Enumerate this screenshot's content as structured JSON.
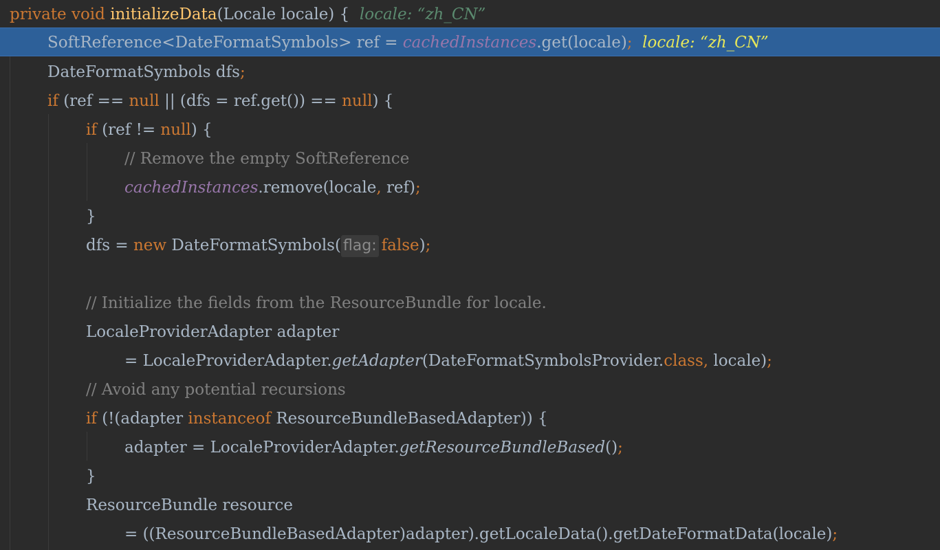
{
  "editor": {
    "lines": [
      {
        "tokens": [
          [
            "kw",
            "private "
          ],
          [
            "kw",
            "void "
          ],
          [
            "fn",
            "initializeData"
          ],
          [
            "tx",
            "(Locale locale) {  "
          ],
          [
            "iv",
            "locale: “zh_CN”"
          ]
        ]
      },
      {
        "tokens": [
          [
            "tx",
            "SoftReference<DateFormatSymbols> ref = "
          ],
          [
            "fi",
            "cachedInstances"
          ],
          [
            "tx",
            ".get(locale)"
          ],
          [
            "pu",
            ";  "
          ],
          [
            "iv-hl",
            "locale: “zh_CN”"
          ]
        ]
      },
      {
        "tokens": [
          [
            "tx",
            "DateFormatSymbols dfs"
          ],
          [
            "pu",
            ";"
          ]
        ]
      },
      {
        "tokens": [
          [
            "kw",
            "if "
          ],
          [
            "tx",
            "(ref == "
          ],
          [
            "kw",
            "null"
          ],
          [
            "tx",
            " || (dfs = ref.get()) == "
          ],
          [
            "kw",
            "null"
          ],
          [
            "tx",
            ") {"
          ]
        ]
      },
      {
        "tokens": [
          [
            "kw",
            "if "
          ],
          [
            "tx",
            "(ref != "
          ],
          [
            "kw",
            "null"
          ],
          [
            "tx",
            ") {"
          ]
        ]
      },
      {
        "tokens": [
          [
            "cm",
            "// Remove the empty SoftReference"
          ]
        ]
      },
      {
        "tokens": [
          [
            "fi",
            "cachedInstances"
          ],
          [
            "tx",
            ".remove(locale"
          ],
          [
            "pu",
            ", "
          ],
          [
            "tx",
            "ref)"
          ],
          [
            "pu",
            ";"
          ]
        ]
      },
      {
        "tokens": [
          [
            "tx",
            "}"
          ]
        ]
      },
      {
        "tokens": [
          [
            "tx",
            "dfs = "
          ],
          [
            "kw",
            "new "
          ],
          [
            "tx",
            "DateFormatSymbols("
          ],
          [
            "hint",
            "flag:"
          ],
          [
            "kw",
            "false"
          ],
          [
            "tx",
            ")"
          ],
          [
            "pu",
            ";"
          ]
        ]
      },
      {
        "tokens": []
      },
      {
        "tokens": [
          [
            "cm",
            "// Initialize the fields from the ResourceBundle for locale."
          ]
        ]
      },
      {
        "tokens": [
          [
            "tx",
            "LocaleProviderAdapter adapter"
          ]
        ]
      },
      {
        "tokens": [
          [
            "tx",
            "= LocaleProviderAdapter."
          ],
          [
            "sm",
            "getAdapter"
          ],
          [
            "tx",
            "(DateFormatSymbolsProvider."
          ],
          [
            "kw",
            "class"
          ],
          [
            "pu",
            ", "
          ],
          [
            "tx",
            "locale)"
          ],
          [
            "pu",
            ";"
          ]
        ]
      },
      {
        "tokens": [
          [
            "cm",
            "// Avoid any potential recursions"
          ]
        ]
      },
      {
        "tokens": [
          [
            "kw",
            "if "
          ],
          [
            "tx",
            "(!(adapter "
          ],
          [
            "kw",
            "instanceof "
          ],
          [
            "tx",
            "ResourceBundleBasedAdapter)) {"
          ]
        ]
      },
      {
        "tokens": [
          [
            "tx",
            "adapter = LocaleProviderAdapter."
          ],
          [
            "sm",
            "getResourceBundleBased"
          ],
          [
            "tx",
            "()"
          ],
          [
            "pu",
            ";"
          ]
        ]
      },
      {
        "tokens": [
          [
            "tx",
            "}"
          ]
        ]
      },
      {
        "tokens": [
          [
            "tx",
            "ResourceBundle resource"
          ]
        ]
      },
      {
        "tokens": [
          [
            "tx",
            "= ((ResourceBundleBasedAdapter)adapter).getLocaleData().getDateFormatData(locale)"
          ],
          [
            "pu",
            ";"
          ]
        ]
      }
    ]
  }
}
